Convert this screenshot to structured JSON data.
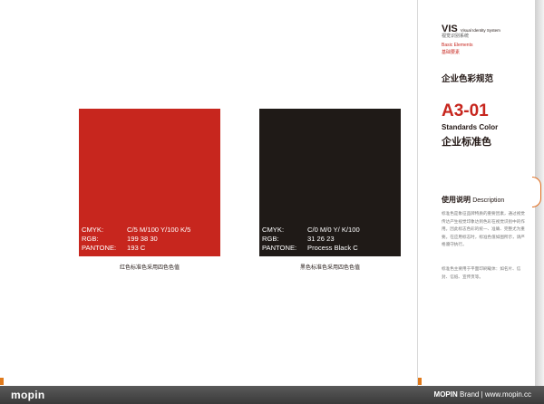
{
  "swatches": [
    {
      "cmyk_label": "CMYK:",
      "cmyk_value": "C/5 M/100 Y/100 K/5",
      "rgb_label": "RGB:",
      "rgb_value": "199  38  30",
      "pantone_label": "PANTONE:",
      "pantone_value": "193 C",
      "caption": "红色标准色采用四色色值",
      "color": "#c7261e"
    },
    {
      "cmyk_label": "CMYK:",
      "cmyk_value": "C/0 M/0 Y/ K/100",
      "rgb_label": "RGB:",
      "rgb_value": "31  26  23",
      "pantone_label": "PANTONE:",
      "pantone_value": "Process Black C",
      "caption": "黑色标准色采用四色色值",
      "color": "#1f1a17"
    }
  ],
  "sidebar": {
    "vis": "VIS",
    "vis_sub": "Visual Identity System",
    "vis_cn": "视觉识别系统",
    "basic": "Basic Elements",
    "basic_cn": "基础要素",
    "section_title": "企业色彩规范",
    "code": "A3-01",
    "standards": "Standards Color",
    "standards_cn": "企业标准色",
    "usage_title": "使用说明",
    "usage_sub": "Description",
    "para1": "标准色是象征品牌特质的重要因素，通过视觉传达产生视觉印象达到色彩在视觉识别中的作用。因此标志色彩的统一、准确、完整尤为重要。在应用标志时，标准色值如图所示，请严格遵守执行。",
    "para2": "标准色主要用于平面印刷载体：如名片、信封、信纸、宣传页等。"
  },
  "footer": {
    "logo": "mopin",
    "brand_bold": "MOPIN",
    "brand_rest": "Brand | www.mopin.cc"
  }
}
